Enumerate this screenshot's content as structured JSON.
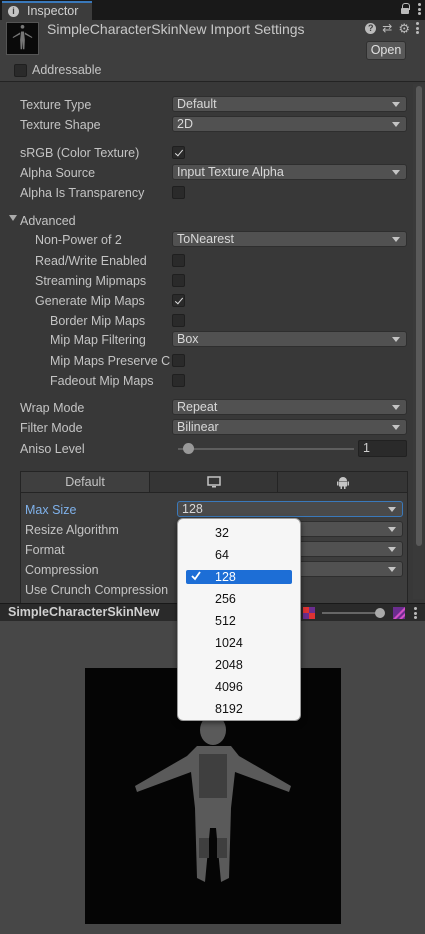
{
  "tab": {
    "label": "Inspector"
  },
  "header": {
    "title": "SimpleCharacterSkinNew Import Settings",
    "open_label": "Open",
    "addressable_label": "Addressable"
  },
  "properties": {
    "texture_type": {
      "label": "Texture Type",
      "value": "Default"
    },
    "texture_shape": {
      "label": "Texture Shape",
      "value": "2D"
    },
    "srgb": {
      "label": "sRGB (Color Texture)",
      "checked": true
    },
    "alpha_source": {
      "label": "Alpha Source",
      "value": "Input Texture Alpha"
    },
    "alpha_transparency": {
      "label": "Alpha Is Transparency",
      "checked": false
    },
    "advanced": {
      "label": "Advanced"
    },
    "non_power_of_2": {
      "label": "Non-Power of 2",
      "value": "ToNearest"
    },
    "read_write": {
      "label": "Read/Write Enabled",
      "checked": false
    },
    "streaming_mipmaps": {
      "label": "Streaming Mipmaps",
      "checked": false
    },
    "generate_mipmaps": {
      "label": "Generate Mip Maps",
      "checked": true
    },
    "border_mipmaps": {
      "label": "Border Mip Maps",
      "checked": false
    },
    "mipmap_filtering": {
      "label": "Mip Map Filtering",
      "value": "Box"
    },
    "mipmaps_preserve": {
      "label": "Mip Maps Preserve C",
      "checked": false
    },
    "fadeout_mipmaps": {
      "label": "Fadeout Mip Maps",
      "checked": false
    },
    "wrap_mode": {
      "label": "Wrap Mode",
      "value": "Repeat"
    },
    "filter_mode": {
      "label": "Filter Mode",
      "value": "Bilinear"
    },
    "aniso_level": {
      "label": "Aniso Level",
      "value": "1",
      "fraction": 0.0
    }
  },
  "platform_tabs": [
    {
      "label": "Default",
      "icon": ""
    },
    {
      "label": "",
      "icon": "monitor-icon"
    },
    {
      "label": "",
      "icon": "android-icon"
    }
  ],
  "platform": {
    "max_size": {
      "label": "Max Size",
      "value": "128"
    },
    "resize_algorithm": {
      "label": "Resize Algorithm"
    },
    "format": {
      "label": "Format"
    },
    "compression": {
      "label": "Compression"
    },
    "crunch": {
      "label": "Use Crunch Compression"
    }
  },
  "preview": {
    "title": "SimpleCharacterSkinNew"
  },
  "max_size_options": [
    "32",
    "64",
    "128",
    "256",
    "512",
    "1024",
    "2048",
    "4096",
    "8192"
  ],
  "selected_option": "128",
  "colors": {
    "accent": "#3a79bb",
    "selection": "#1d6ed6",
    "panel": "#383838"
  }
}
